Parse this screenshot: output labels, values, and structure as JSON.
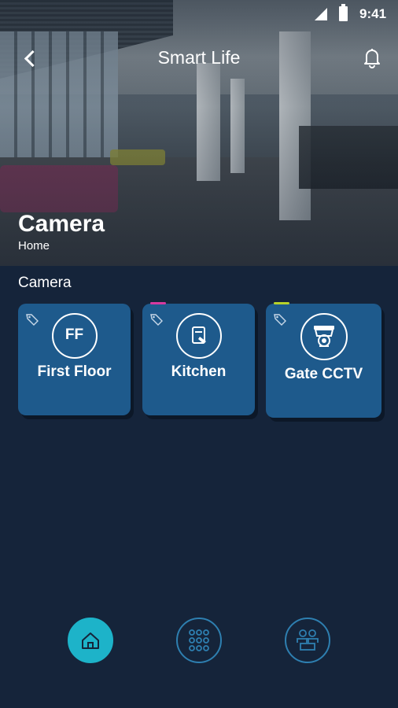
{
  "status_bar": {
    "time": "9:41"
  },
  "app_bar": {
    "title": "Smart Life"
  },
  "hero": {
    "title": "Camera",
    "subtitle": "Home"
  },
  "section": {
    "title": "Camera"
  },
  "cards": [
    {
      "label": "First Floor",
      "icon_text": "FF",
      "icon": "ff-initials-icon",
      "accent": ""
    },
    {
      "label": "Kitchen",
      "icon": "kitchen-icon",
      "accent": "#d63aa0"
    },
    {
      "label": "Gate CCTV",
      "icon": "cctv-camera-icon",
      "accent": "#b6d22a"
    }
  ],
  "bottom_nav": [
    {
      "name": "home",
      "icon": "home-icon",
      "active": true
    },
    {
      "name": "apps",
      "icon": "grid-icon",
      "active": false
    },
    {
      "name": "people",
      "icon": "people-icon",
      "active": false
    }
  ],
  "colors": {
    "background": "#15243a",
    "card": "#1e5a8c",
    "active_nav": "#1db3c9",
    "nav_border": "#2e7fb0"
  }
}
